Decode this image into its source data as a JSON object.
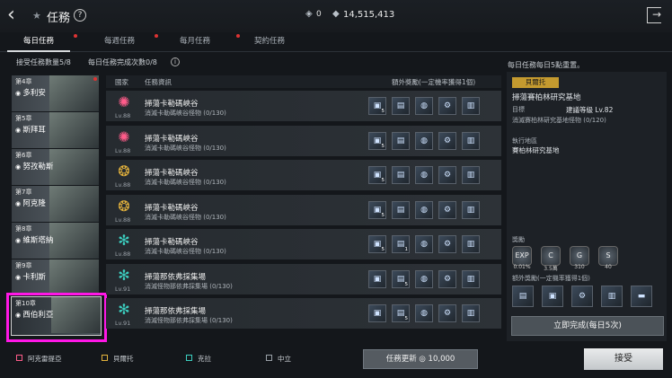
{
  "header": {
    "back_icon": "chevron-left-icon",
    "star_icon": "star-icon",
    "title": "任務",
    "help": "?",
    "currency1_icon": "ticket-icon",
    "currency1": "0",
    "currency2_icon": "gem-icon",
    "currency2": "14,515,413",
    "exit_icon": "exit-icon"
  },
  "tabs": [
    {
      "label": "每日任務",
      "active": true
    },
    {
      "label": "每週任務"
    },
    {
      "label": "每月任務"
    },
    {
      "label": "契約任務"
    }
  ],
  "stats": {
    "accepted": "接受任務數量5/8",
    "daily_done": "每日任務完成次數0/8",
    "info": "i",
    "reset_note": "每日任務每日5點重置。"
  },
  "chapters": [
    {
      "chapter": "第4章",
      "name": "多利安"
    },
    {
      "chapter": "第5章",
      "name": "斯拜耳"
    },
    {
      "chapter": "第6章",
      "name": "努孜勒斯"
    },
    {
      "chapter": "第7章",
      "name": "阿克隆"
    },
    {
      "chapter": "第8章",
      "name": "維斯塔納"
    },
    {
      "chapter": "第9章",
      "name": "卡利斯"
    },
    {
      "chapter": "第10章",
      "name": "西伯利亞",
      "selected": true
    }
  ],
  "table": {
    "col_country": "國家",
    "col_info": "任務資訊",
    "col_reward": "額外獎勵(一定機率獲得1個)"
  },
  "rows": [
    {
      "emblem": "pink",
      "lv": "Lv.88",
      "title": "掃蕩卡勒碼峽谷",
      "sub": "消滅卡勒碼峽谷怪物 (0/130)",
      "items": [
        "5",
        "",
        "",
        "",
        ""
      ]
    },
    {
      "emblem": "pink",
      "lv": "Lv.88",
      "title": "掃蕩卡勒碼峽谷",
      "sub": "消滅卡勒碼峽谷怪物 (0/130)",
      "items": [
        "5",
        "",
        "",
        "",
        ""
      ]
    },
    {
      "emblem": "gold",
      "lv": "Lv.88",
      "title": "掃蕩卡勒碼峽谷",
      "sub": "消滅卡勒碼峽谷怪物 (0/130)",
      "items": [
        "5",
        "",
        "",
        "",
        ""
      ]
    },
    {
      "emblem": "gold",
      "lv": "Lv.88",
      "title": "掃蕩卡勒碼峽谷",
      "sub": "消滅卡勒碼峽谷怪物 (0/130)",
      "items": [
        "5",
        "",
        "",
        "",
        ""
      ]
    },
    {
      "emblem": "teal",
      "lv": "Lv.88",
      "title": "掃蕩卡勒碼峽谷",
      "sub": "消滅卡勒碼峽谷怪物 (0/130)",
      "items": [
        "5",
        "1",
        "",
        "",
        ""
      ]
    },
    {
      "emblem": "teal",
      "lv": "Lv.91",
      "title": "掃蕩那依弗採集場",
      "sub": "消滅怪物那依弗採集場 (0/130)",
      "items": [
        "",
        "5",
        "",
        "",
        ""
      ]
    },
    {
      "emblem": "teal",
      "lv": "Lv.91",
      "title": "掃蕩那依弗採集場",
      "sub": "消滅怪物那依弗採集場 (0/130)",
      "items": [
        "",
        "5",
        "",
        "",
        ""
      ]
    }
  ],
  "detail": {
    "badge": "貝爾托",
    "title": "掃蕩賽柏林研究基地",
    "target_label": "目標",
    "target_req": "建議等級 Lv.82",
    "target_task": "消滅賽柏林研究基地怪物 (0/120)",
    "area_label": "執行地區",
    "area": "賽柏林研究基地",
    "reward_label": "獎勵",
    "rewards": [
      {
        "icon": "EXP",
        "val": "0.01%"
      },
      {
        "icon": "C",
        "val": "3.5萬"
      },
      {
        "icon": "G",
        "val": "310"
      },
      {
        "icon": "S",
        "val": "40"
      }
    ],
    "extra_label": "額外獎勵(一定機率獲得1個)",
    "complete_label": "立即完成(每日5次)"
  },
  "legend": [
    {
      "label": "阿克雷提亞",
      "color": "#ff5c8a"
    },
    {
      "label": "貝爾托",
      "color": "#e3b23c"
    },
    {
      "label": "克拉",
      "color": "#3ccfc0"
    },
    {
      "label": "中立",
      "color": "#9aa1a8"
    }
  ],
  "footer": {
    "refresh_label": "任務更新",
    "refresh_cost": "10,000",
    "accept_label": "接受"
  }
}
